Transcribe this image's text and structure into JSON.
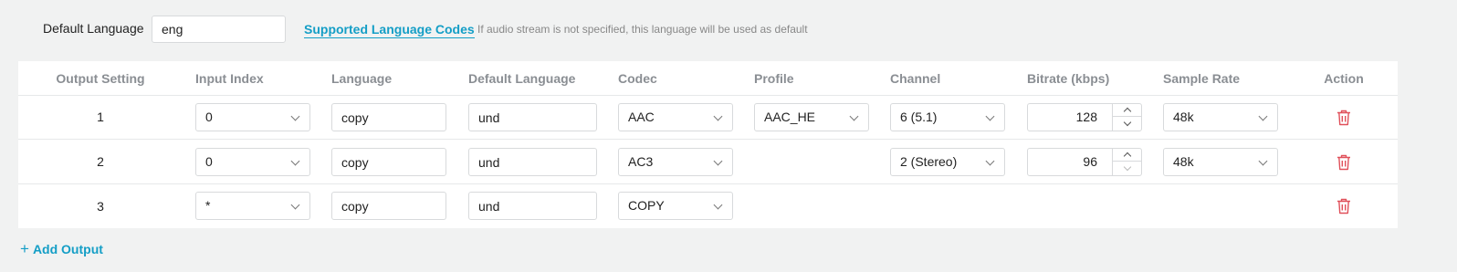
{
  "default_language": {
    "label": "Default Language",
    "value": "eng",
    "link": "Supported Language Codes",
    "hint": "If audio stream is not specified, this language will be used as default"
  },
  "table": {
    "headers": [
      "Output Setting",
      "Input Index",
      "Language",
      "Default Language",
      "Codec",
      "Profile",
      "Channel",
      "Bitrate (kbps)",
      "Sample Rate",
      "Action"
    ],
    "rows": [
      {
        "output": "1",
        "input_index": "0",
        "language": "copy",
        "default_language": "und",
        "codec": "AAC",
        "profile": "AAC_HE",
        "channel": "6 (5.1)",
        "bitrate": "128",
        "sample_rate": "48k"
      },
      {
        "output": "2",
        "input_index": "0",
        "language": "copy",
        "default_language": "und",
        "codec": "AC3",
        "profile": "",
        "channel": "2 (Stereo)",
        "bitrate": "96",
        "sample_rate": "48k"
      },
      {
        "output": "3",
        "input_index": "*",
        "language": "copy",
        "default_language": "und",
        "codec": "COPY",
        "profile": "",
        "channel": "",
        "bitrate": "",
        "sample_rate": ""
      }
    ]
  },
  "add_output": {
    "label": "Add Output",
    "icon": "plus-icon"
  },
  "colors": {
    "accent": "#149ec6",
    "danger": "#e0505a",
    "background": "#f1f2f2"
  },
  "icons": {
    "delete": "trash-icon",
    "dropdown": "chevron-down-icon",
    "increment": "chevron-up-icon",
    "decrement": "chevron-down-icon"
  }
}
